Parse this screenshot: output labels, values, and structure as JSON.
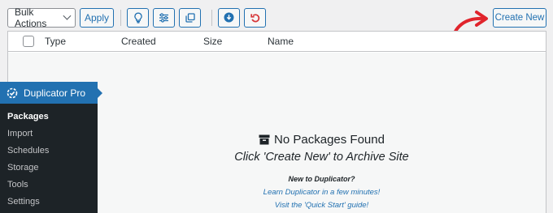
{
  "toolbar": {
    "bulk_actions": "Bulk Actions",
    "apply": "Apply",
    "create_new": "Create New"
  },
  "table": {
    "columns": [
      "Type",
      "Created",
      "Size",
      "Name"
    ]
  },
  "empty_state": {
    "title": "No Packages Found",
    "subtitle": "Click 'Create New' to Archive Site",
    "new_to": "New to Duplicator?",
    "link_learn": "Learn Duplicator in a few minutes!",
    "link_quick_start": "Visit the 'Quick Start' guide!"
  },
  "sidebar": {
    "title": "Duplicator Pro",
    "items": [
      {
        "label": "Packages",
        "active": true
      },
      {
        "label": "Import"
      },
      {
        "label": "Schedules"
      },
      {
        "label": "Storage"
      },
      {
        "label": "Tools"
      },
      {
        "label": "Settings"
      }
    ]
  },
  "colors": {
    "accent": "#2271b1",
    "danger": "#d63638",
    "annotation_arrow": "#e0242c",
    "sidebar_bg": "#1d2327"
  },
  "icons": [
    "lightbulb-icon",
    "sliders-icon",
    "copy-icon",
    "download-circle-icon",
    "undo-icon",
    "archive-box-icon",
    "duplicator-logo-icon",
    "red-arrow-annotation"
  ]
}
